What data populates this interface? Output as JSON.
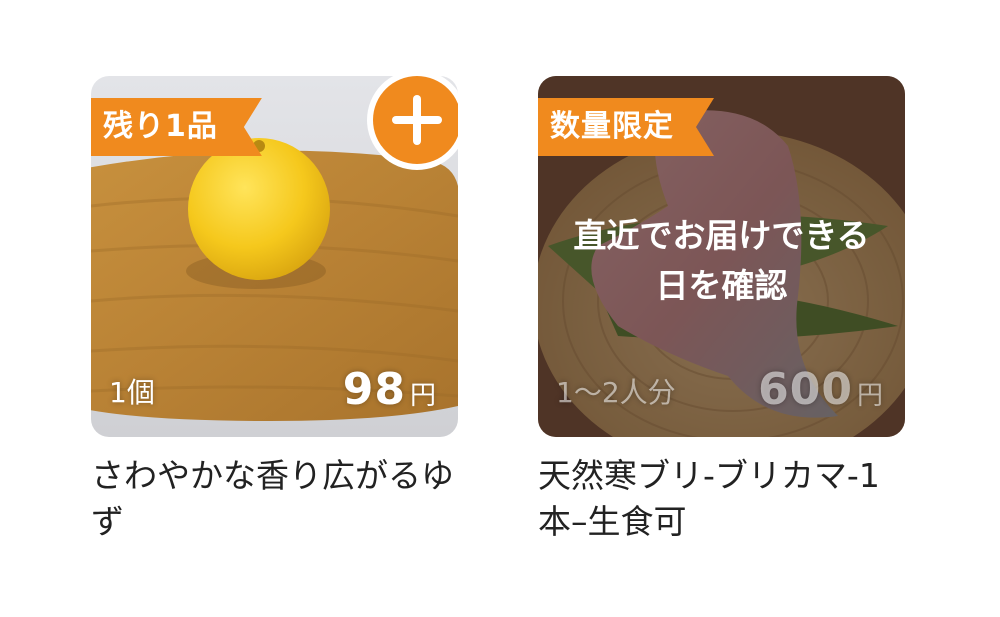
{
  "products": [
    {
      "badge": "残り1品",
      "quantity": "1個",
      "price": "98",
      "price_unit": "円",
      "title": "さわやかな香り広がるゆず",
      "add_button": "add",
      "image": "yuzu-on-cutting-board"
    },
    {
      "badge": "数量限定",
      "quantity": "1〜2人分",
      "price": "600",
      "price_unit": "円",
      "title": "天然寒ブリ-ブリカマ-1本–生食可",
      "overlay": "直近でお届けできる日を確認",
      "image": "buri-kama-on-bamboo-tray"
    }
  ],
  "colors": {
    "accent": "#f08a1e",
    "text": "#222222"
  }
}
